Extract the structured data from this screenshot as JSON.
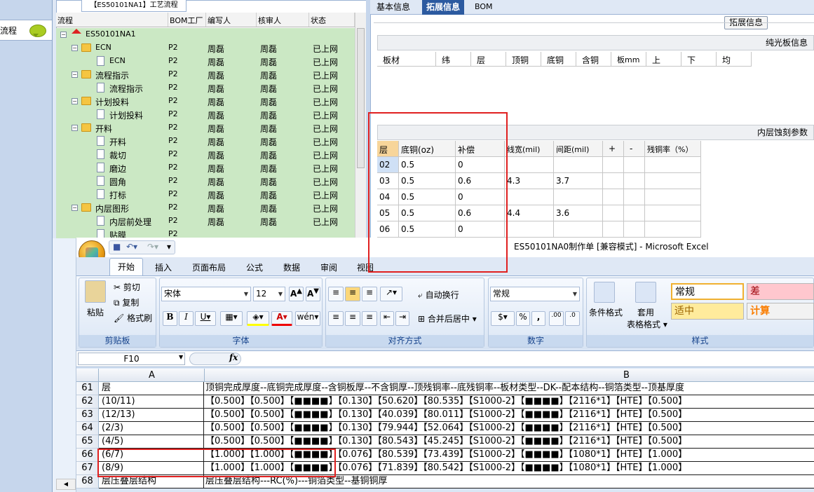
{
  "leftnav": {
    "item": "流程"
  },
  "tree": {
    "title": "【ES50101NA1】工艺流程",
    "headers": [
      "流程",
      "BOM工厂",
      "编写人",
      "核审人",
      "状态"
    ],
    "root": {
      "label": "ES50101NA1"
    },
    "rows": [
      {
        "label": "ECN",
        "factory": "P2",
        "writer": "周磊",
        "reviewer": "周磊",
        "status": "已上网"
      },
      {
        "label": "ECN",
        "factory": "P2",
        "writer": "周磊",
        "reviewer": "周磊",
        "status": "已上网"
      },
      {
        "label": "流程指示",
        "factory": "P2",
        "writer": "周磊",
        "reviewer": "周磊",
        "status": "已上网"
      },
      {
        "label": "流程指示",
        "factory": "P2",
        "writer": "周磊",
        "reviewer": "周磊",
        "status": "已上网"
      },
      {
        "label": "计划投料",
        "factory": "P2",
        "writer": "周磊",
        "reviewer": "周磊",
        "status": "已上网"
      },
      {
        "label": "计划投料",
        "factory": "P2",
        "writer": "周磊",
        "reviewer": "周磊",
        "status": "已上网"
      },
      {
        "label": "开料",
        "factory": "P2",
        "writer": "周磊",
        "reviewer": "周磊",
        "status": "已上网"
      },
      {
        "label": "开料",
        "factory": "P2",
        "writer": "周磊",
        "reviewer": "周磊",
        "status": "已上网"
      },
      {
        "label": "裁切",
        "factory": "P2",
        "writer": "周磊",
        "reviewer": "周磊",
        "status": "已上网"
      },
      {
        "label": "磨边",
        "factory": "P2",
        "writer": "周磊",
        "reviewer": "周磊",
        "status": "已上网"
      },
      {
        "label": "圆角",
        "factory": "P2",
        "writer": "周磊",
        "reviewer": "周磊",
        "status": "已上网"
      },
      {
        "label": "打标",
        "factory": "P2",
        "writer": "周磊",
        "reviewer": "周磊",
        "status": "已上网"
      },
      {
        "label": "内层图形",
        "factory": "P2",
        "writer": "周磊",
        "reviewer": "周磊",
        "status": "已上网"
      },
      {
        "label": "内层前处理",
        "factory": "P2",
        "writer": "周磊",
        "reviewer": "周磊",
        "status": "已上网"
      },
      {
        "label": "贴膜",
        "factory": "P2",
        "writer": "",
        "reviewer": "",
        "status": ""
      }
    ]
  },
  "right": {
    "tabs": [
      "基本信息",
      "拓展信息",
      "BOM"
    ],
    "ext_button": "拓展信息",
    "section1": "纯光板信息",
    "grid1_headers": [
      "板材",
      "纬",
      "层",
      "顶铜",
      "底铜",
      "含铜",
      "板mm",
      "上",
      "下",
      "均"
    ],
    "section2": "内层蚀刻参数",
    "grid2_headers": [
      "层",
      "底铜(oz)",
      "补偿",
      "线宽(mil)",
      "间距(mil)",
      "+",
      "-",
      "残铜率（%）"
    ],
    "grid2_rows": [
      [
        "02",
        "0.5",
        "0",
        "",
        ""
      ],
      [
        "03",
        "0.5",
        "0.6",
        "4.3",
        "3.7"
      ],
      [
        "04",
        "0.5",
        "0",
        "",
        ""
      ],
      [
        "05",
        "0.5",
        "0.6",
        "4.4",
        "3.6"
      ],
      [
        "06",
        "0.5",
        "0",
        "",
        ""
      ]
    ]
  },
  "excel": {
    "title": "ES50101NA0制作单 [兼容模式] - Microsoft Excel",
    "tabs": [
      "开始",
      "插入",
      "页面布局",
      "公式",
      "数据",
      "审阅",
      "视图"
    ],
    "clipboard": {
      "paste": "粘贴",
      "cut": "剪切",
      "copy": "复制",
      "painter": "格式刷",
      "label": "剪贴板"
    },
    "font": {
      "name": "宋体",
      "size": "12",
      "label": "字体"
    },
    "align": {
      "wrap": "自动换行",
      "merge": "合并后居中",
      "label": "对齐方式"
    },
    "number": {
      "format": "常规",
      "label": "数字"
    },
    "styles": {
      "cond": "条件格式",
      "apply1": "套用",
      "apply2": "表格格式",
      "normal": "常规",
      "bad": "差",
      "neutral": "适中",
      "calc": "计算",
      "label": "样式"
    },
    "namebox": "F10",
    "fx": "fx",
    "columns": [
      "A",
      "B"
    ],
    "rows": [
      {
        "num": "61",
        "a": "层",
        "b": "顶铜完成厚度--底铜完成厚度--含铜板厚--不含铜厚--顶残铜率--底残铜率--板材类型--DK--配本结构--铜箔类型--顶基厚度"
      },
      {
        "num": "62",
        "a": "(10/11)",
        "b": "【0.500】【0.500】【■■■■】【0.130】【50.620】【80.535】【S1000-2】【■■■■】【2116*1】【HTE】【0.500】"
      },
      {
        "num": "63",
        "a": "(12/13)",
        "b": "【0.500】【0.500】【■■■■】【0.130】【40.039】【80.011】【S1000-2】【■■■■】【2116*1】【HTE】【0.500】"
      },
      {
        "num": "64",
        "a": "(2/3)",
        "b": "【0.500】【0.500】【■■■■】【0.130】【79.944】【52.064】【S1000-2】【■■■■】【2116*1】【HTE】【0.500】"
      },
      {
        "num": "65",
        "a": "(4/5)",
        "b": "【0.500】【0.500】【■■■■】【0.130】【80.543】【45.245】【S1000-2】【■■■■】【2116*1】【HTE】【0.500】"
      },
      {
        "num": "66",
        "a": "(6/7)",
        "b": "【1.000】【1.000】【■■■■】【0.076】【80.539】【73.439】【S1000-2】【■■■■】【1080*1】【HTE】【1.000】"
      },
      {
        "num": "67",
        "a": "(8/9)",
        "b": "【1.000】【1.000】【■■■■】【0.076】【71.839】【80.542】【S1000-2】【■■■■】【1080*1】【HTE】【1.000】"
      },
      {
        "num": "68",
        "a": "层压叠层结构",
        "b": "层压叠层结构---RC(%)---铜箔类型--基铜铜厚"
      }
    ]
  }
}
